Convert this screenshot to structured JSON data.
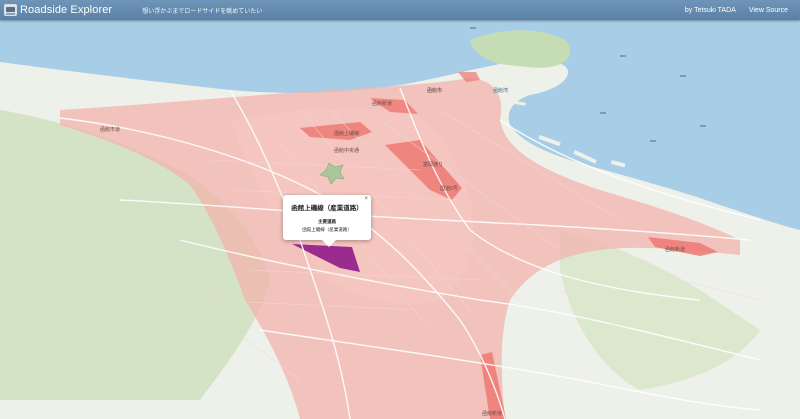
{
  "app": {
    "title": "Roadside Explorer",
    "tagline": "想い浮かぶまでロードサイドを眺めていたい",
    "author_link": "by Tetsuki TADA",
    "source_link": "View Source"
  },
  "map": {
    "city_label": "函館市",
    "place_labels": {
      "bay": "函館湾",
      "road_west": "函館市道",
      "road_mid": "函館中央通",
      "road_east": "富岡通り",
      "road_north": "函館新道",
      "road_south": "国道5号",
      "road_harbor": "函館上磯線",
      "road_coast": "函館新道",
      "road_bottom": "函館新道"
    },
    "colors": {
      "water": "#a9cde6",
      "land": "#eef0ea",
      "roadside_area": "#f3b4ac",
      "highlight": "#ee6b6b",
      "selected": "#9b2c8f"
    }
  },
  "popup": {
    "title": "函館上磯線（産業道路）",
    "road_type": "主要道路",
    "road_name": "函館上磯線（産業道路）",
    "close_symbol": "×"
  }
}
